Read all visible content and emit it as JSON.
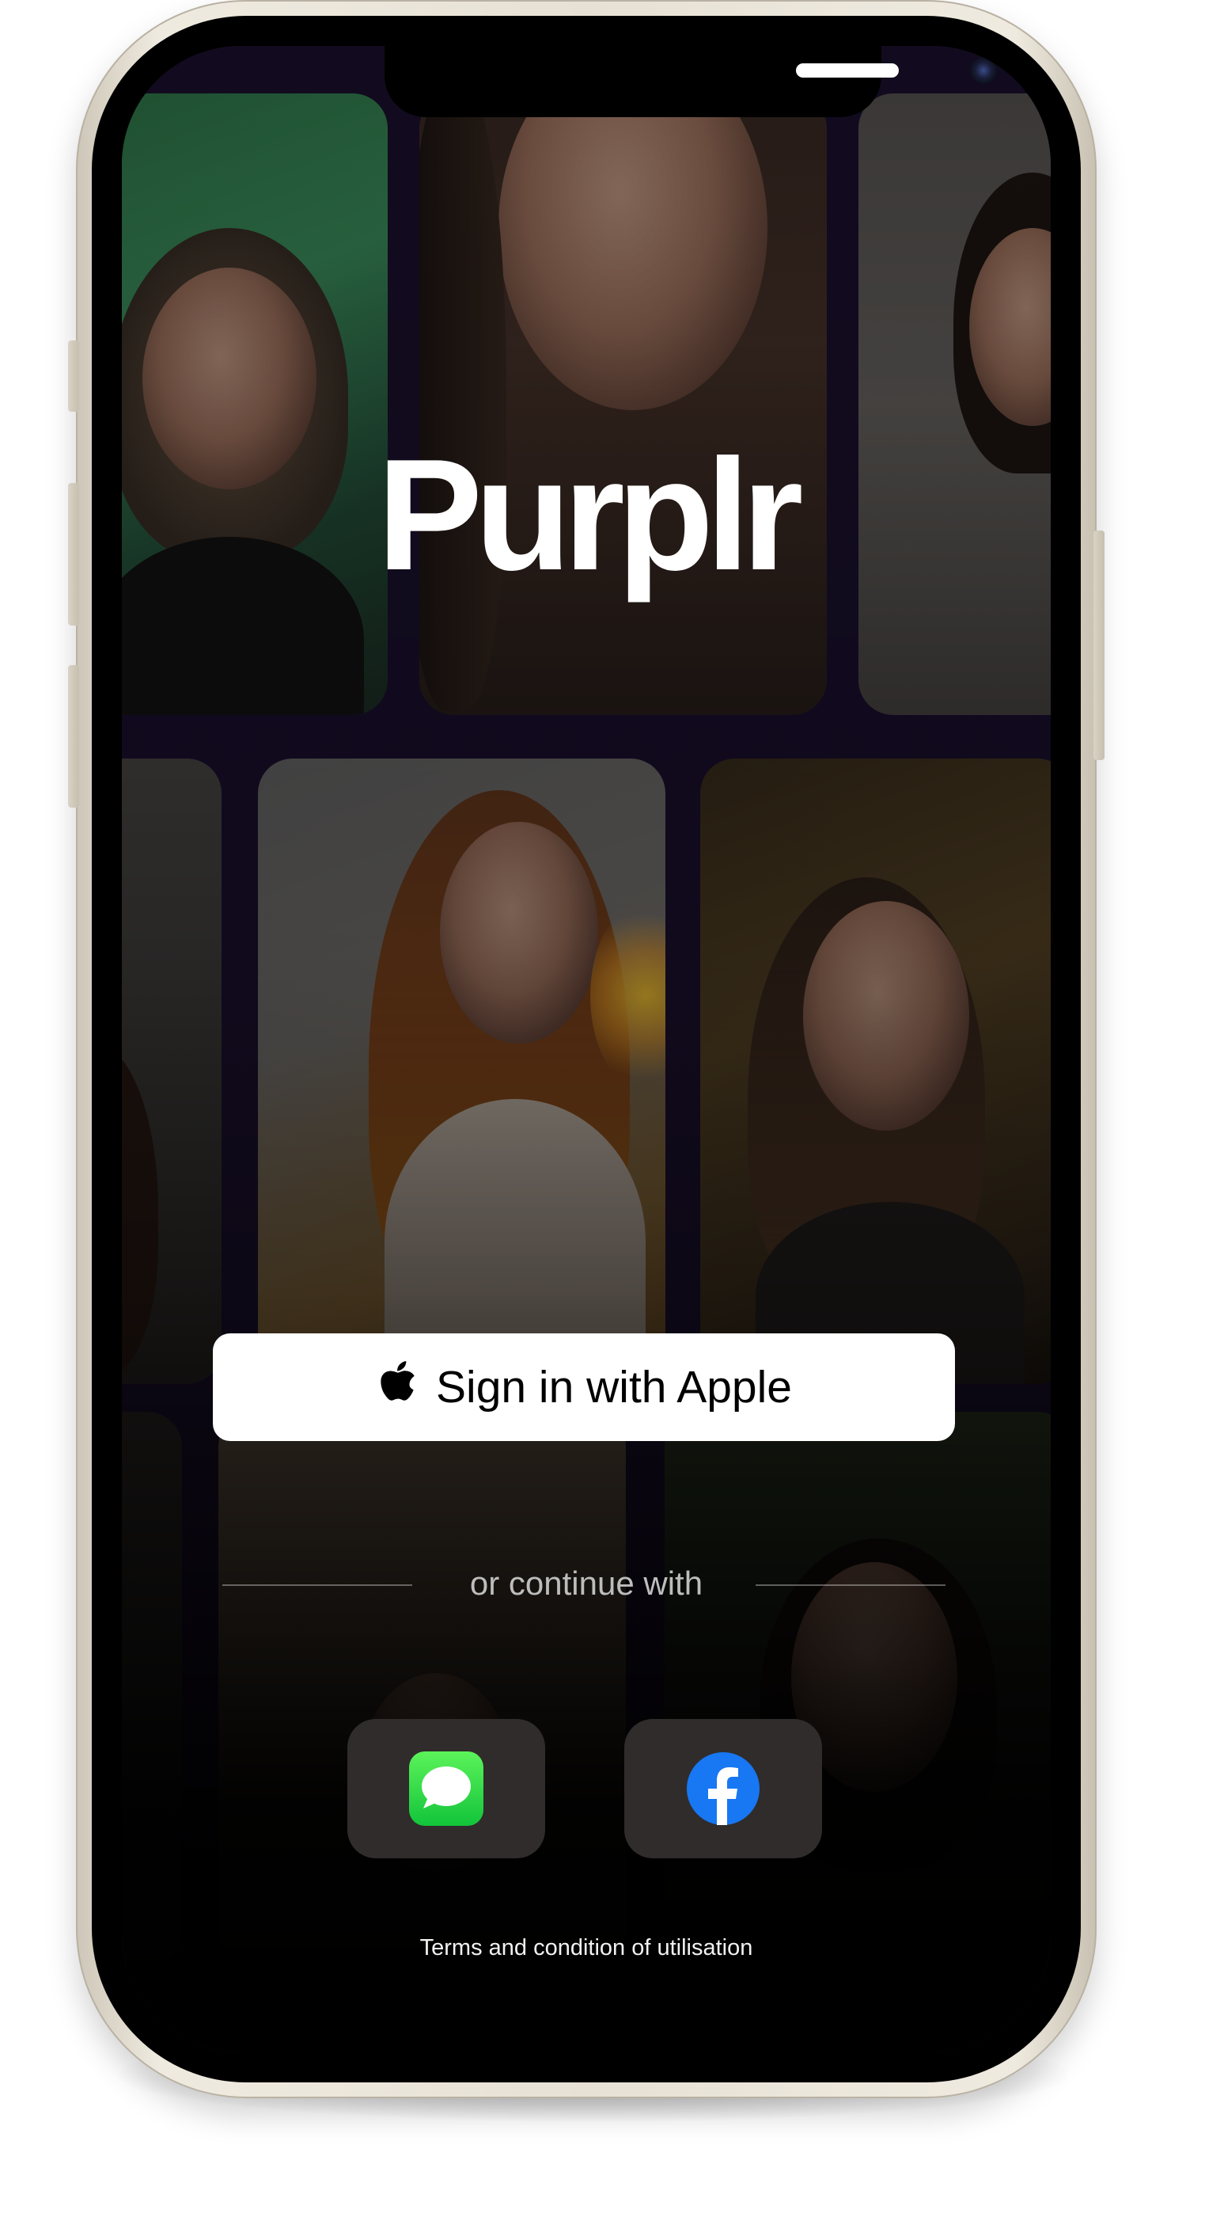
{
  "app": {
    "name": "Purplr"
  },
  "auth": {
    "apple_button_label": "Sign in with Apple",
    "divider_text": "or continue with",
    "social_buttons": [
      {
        "name": "messages",
        "icon": "messages-icon",
        "color": "#1fc93a"
      },
      {
        "name": "facebook",
        "icon": "facebook-icon",
        "color": "#1877f2"
      }
    ],
    "terms_text": "Terms and condition of utilisation"
  },
  "colors": {
    "background_purple": "#1c1130",
    "button_bg": "#ffffff",
    "social_bg": "#2f2c2b"
  }
}
